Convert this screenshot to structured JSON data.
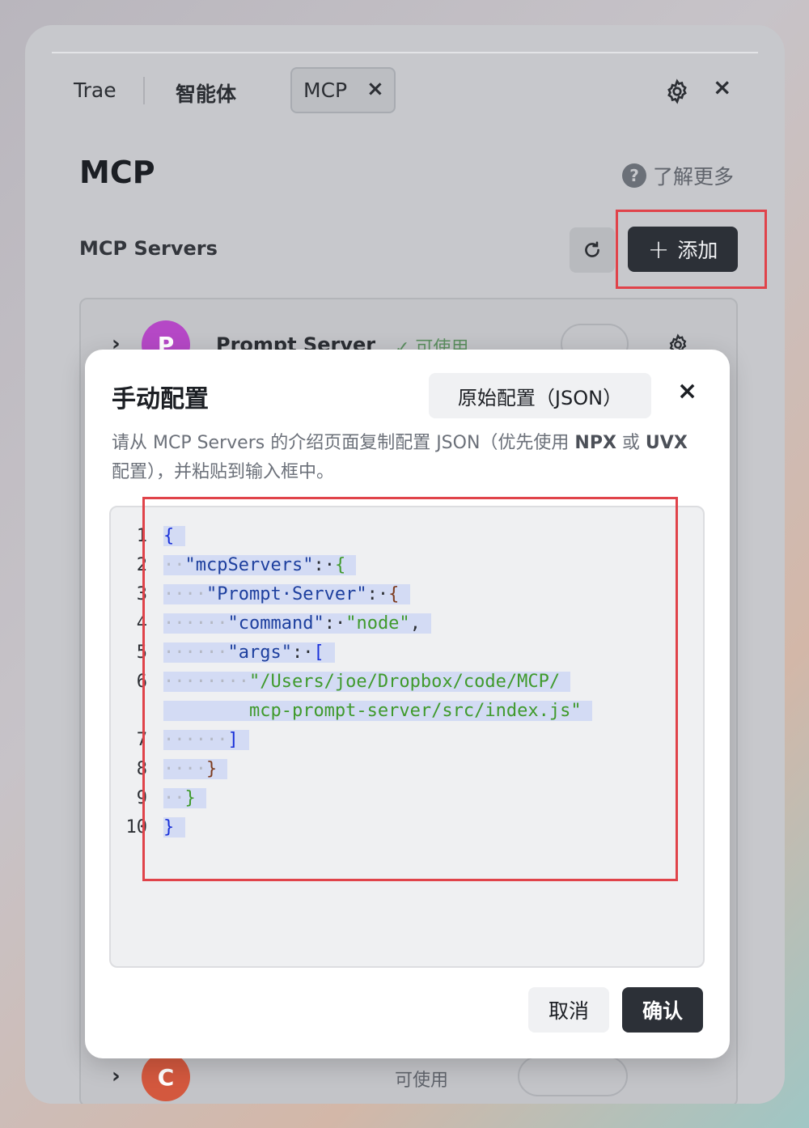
{
  "tabs": [
    {
      "label": "Trae"
    },
    {
      "label": "智能体"
    },
    {
      "label": "MCP",
      "close": "×"
    }
  ],
  "window": {
    "close": "×"
  },
  "page": {
    "title": "MCP",
    "learn_more": "了解更多",
    "help_glyph": "?"
  },
  "servers": {
    "label": "MCP Servers",
    "add_button": "添加",
    "add_glyph": "+",
    "rows": [
      {
        "chevron": "›",
        "avatar": "P",
        "avatar_color": "#b548c6",
        "name": "Prompt Server",
        "status": "✓ 可使用"
      },
      {
        "chevron": "›",
        "avatar": "C",
        "avatar_color": "#d3583e",
        "name": "",
        "status": "可使用"
      }
    ]
  },
  "modal": {
    "title": "手动配置",
    "raw_config_button": "原始配置（JSON）",
    "close": "×",
    "description_1": "请从 MCP Servers 的介绍页面复制配置 JSON（优先使用 ",
    "description_npx": "NPX",
    "description_2": " 或 ",
    "description_uvx": "UVX",
    "description_3": " 配置），并粘贴到输入框中。",
    "cancel_button": "取消",
    "confirm_button": "确认"
  },
  "editor": {
    "line_numbers": [
      "1",
      "2",
      "3",
      "4",
      "5",
      "6",
      "",
      "7",
      "8",
      "9",
      "10"
    ],
    "lines": [
      {
        "ind": "",
        "parts": [
          {
            "t": "{",
            "c": "b1"
          }
        ]
      },
      {
        "ind": "··",
        "parts": [
          {
            "t": "\"mcpServers\"",
            "c": "k"
          },
          {
            "t": ":·",
            "c": "p"
          },
          {
            "t": "{",
            "c": "b2"
          }
        ]
      },
      {
        "ind": "····",
        "parts": [
          {
            "t": "\"Prompt·Server\"",
            "c": "k"
          },
          {
            "t": ":·",
            "c": "p"
          },
          {
            "t": "{",
            "c": "b3"
          }
        ]
      },
      {
        "ind": "······",
        "parts": [
          {
            "t": "\"command\"",
            "c": "k"
          },
          {
            "t": ":·",
            "c": "p"
          },
          {
            "t": "\"node\"",
            "c": "s"
          },
          {
            "t": ",",
            "c": "p"
          }
        ]
      },
      {
        "ind": "······",
        "parts": [
          {
            "t": "\"args\"",
            "c": "k"
          },
          {
            "t": ":·",
            "c": "p"
          },
          {
            "t": "[",
            "c": "b1"
          }
        ]
      },
      {
        "ind": "········",
        "parts": [
          {
            "t": "\"/Users/joe/Dropbox/code/MCP/",
            "c": "s"
          }
        ]
      },
      {
        "ind": "        ",
        "parts": [
          {
            "t": "mcp-prompt-server/src/index.js\"",
            "c": "s"
          }
        ]
      },
      {
        "ind": "······",
        "parts": [
          {
            "t": "]",
            "c": "b1"
          }
        ]
      },
      {
        "ind": "····",
        "parts": [
          {
            "t": "}",
            "c": "b3"
          }
        ]
      },
      {
        "ind": "··",
        "parts": [
          {
            "t": "}",
            "c": "b2"
          }
        ]
      },
      {
        "ind": "",
        "parts": [
          {
            "t": "}",
            "c": "b1"
          }
        ]
      }
    ]
  }
}
